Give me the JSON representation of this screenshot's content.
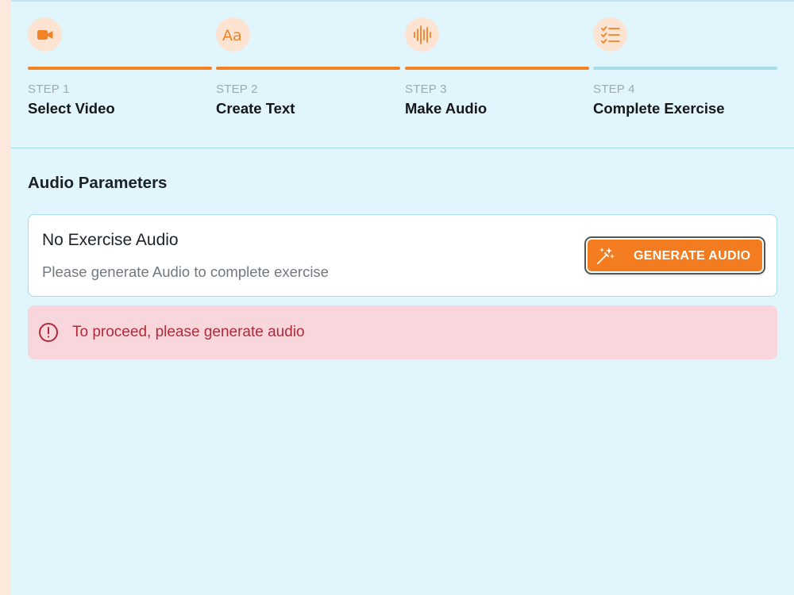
{
  "stepper": {
    "steps": [
      {
        "label": "STEP 1",
        "title": "Select Video",
        "icon": "video-camera-icon",
        "complete": true
      },
      {
        "label": "STEP 2",
        "title": "Create Text",
        "icon": "text-aa-icon",
        "complete": true
      },
      {
        "label": "STEP 3",
        "title": "Make Audio",
        "icon": "audio-waveform-icon",
        "complete": true
      },
      {
        "label": "STEP 4",
        "title": "Complete Exercise",
        "icon": "checklist-icon",
        "complete": false
      }
    ],
    "active_color": "#f28325",
    "inactive_color": "#a7dde6"
  },
  "audio_section": {
    "title": "Audio Parameters",
    "card": {
      "title": "No Exercise Audio",
      "subtitle": "Please generate Audio to complete exercise",
      "button_label": "GENERATE AUDIO",
      "button_icon": "magic-wand-icon"
    }
  },
  "alert": {
    "icon": "alert-circle-icon",
    "message": "To proceed, please generate audio"
  },
  "colors": {
    "accent": "#f47c20",
    "background": "#e0f5fc",
    "alert_bg": "#f9d6dc",
    "alert_text": "#b02b3a"
  }
}
